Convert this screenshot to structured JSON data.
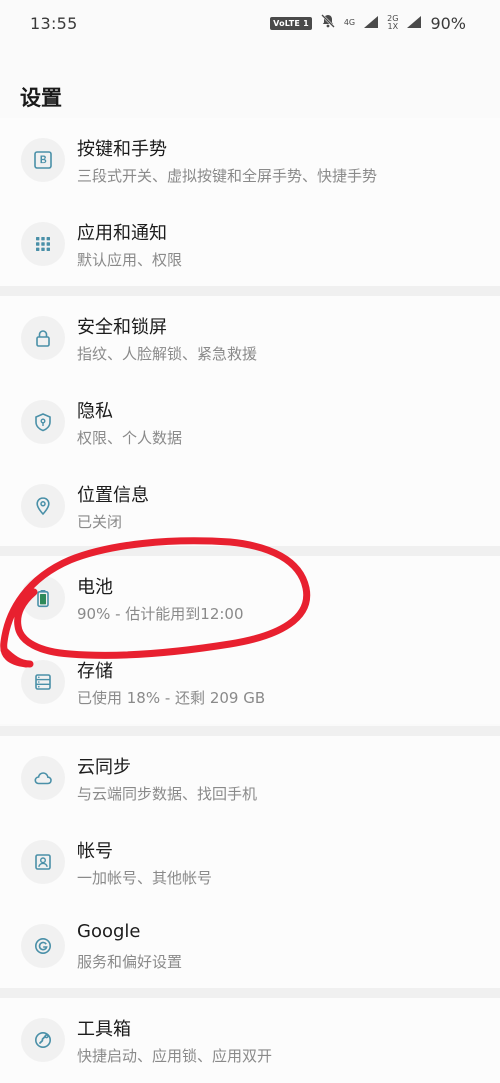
{
  "status": {
    "time": "13:55",
    "volte": "VoLTE 1",
    "net_top": "4G",
    "net2_top": "2G",
    "net2_bottom": "1X",
    "battery": "90%"
  },
  "page_title": "设置",
  "items": [
    {
      "title": "按键和手势",
      "sub": "三段式开关、虚拟按键和全屏手势、快捷手势",
      "icon": "button-b-icon"
    },
    {
      "title": "应用和通知",
      "sub": "默认应用、权限",
      "icon": "apps-grid-icon"
    },
    {
      "title": "安全和锁屏",
      "sub": "指纹、人脸解锁、紧急救援",
      "icon": "lock-icon"
    },
    {
      "title": "隐私",
      "sub": "权限、个人数据",
      "icon": "shield-icon"
    },
    {
      "title": "位置信息",
      "sub": "已关闭",
      "icon": "location-pin-icon"
    },
    {
      "title": "电池",
      "sub": "90% - 估计能用到12:00",
      "icon": "battery-icon"
    },
    {
      "title": "存储",
      "sub": "已使用 18% - 还剩 209 GB",
      "icon": "storage-icon"
    },
    {
      "title": "云同步",
      "sub": "与云端同步数据、找回手机",
      "icon": "cloud-icon"
    },
    {
      "title": "帐号",
      "sub": "一加帐号、其他帐号",
      "icon": "account-icon"
    },
    {
      "title": "Google",
      "sub": "服务和偏好设置",
      "icon": "google-icon"
    },
    {
      "title": "工具箱",
      "sub": "快捷启动、应用锁、应用双开",
      "icon": "toolbox-icon"
    }
  ],
  "colors": {
    "accent": "#4a90a8",
    "annotation": "#e8202f"
  }
}
